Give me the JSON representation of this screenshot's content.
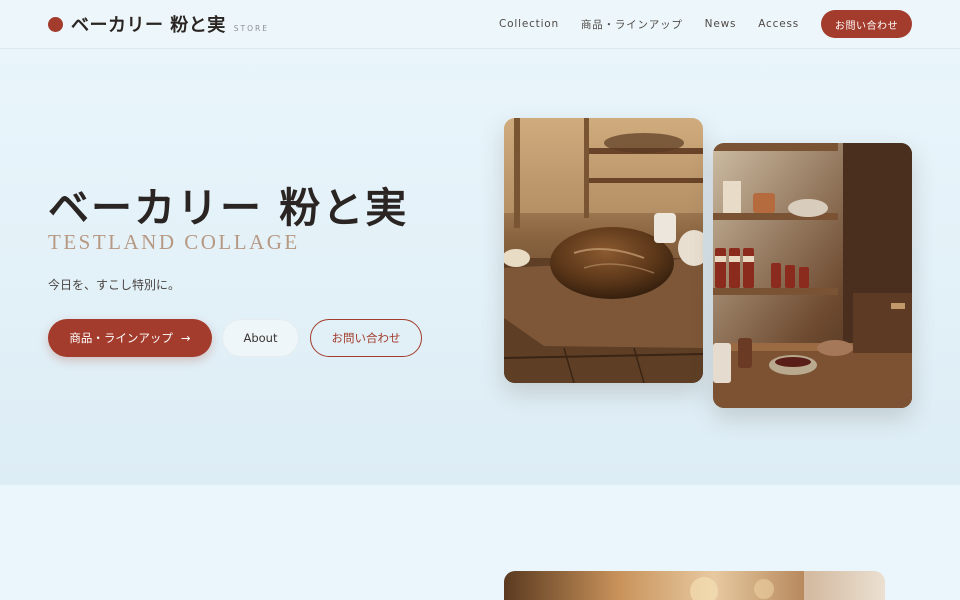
{
  "header": {
    "logo_title": "ベーカリー 粉と実",
    "logo_sub": "STORE",
    "nav": [
      "Collection",
      "商品・ラインアップ",
      "News",
      "Access"
    ],
    "cta": "お問い合わせ"
  },
  "hero": {
    "title": "ベーカリー 粉と実",
    "subtitle": "TESTLAND COLLAGE",
    "tagline": "今日を、すこし特別に。",
    "buttons": {
      "primary": "商品・ラインアップ",
      "primary_arrow": "→",
      "ghost": "About",
      "outline": "お問い合わせ"
    }
  },
  "colors": {
    "accent": "#a33c2c",
    "background": "#eef7fb",
    "subtitle": "#b79883"
  },
  "icons": {
    "logo_mark": "circle-dot-icon",
    "arrow": "arrow-right-icon"
  }
}
